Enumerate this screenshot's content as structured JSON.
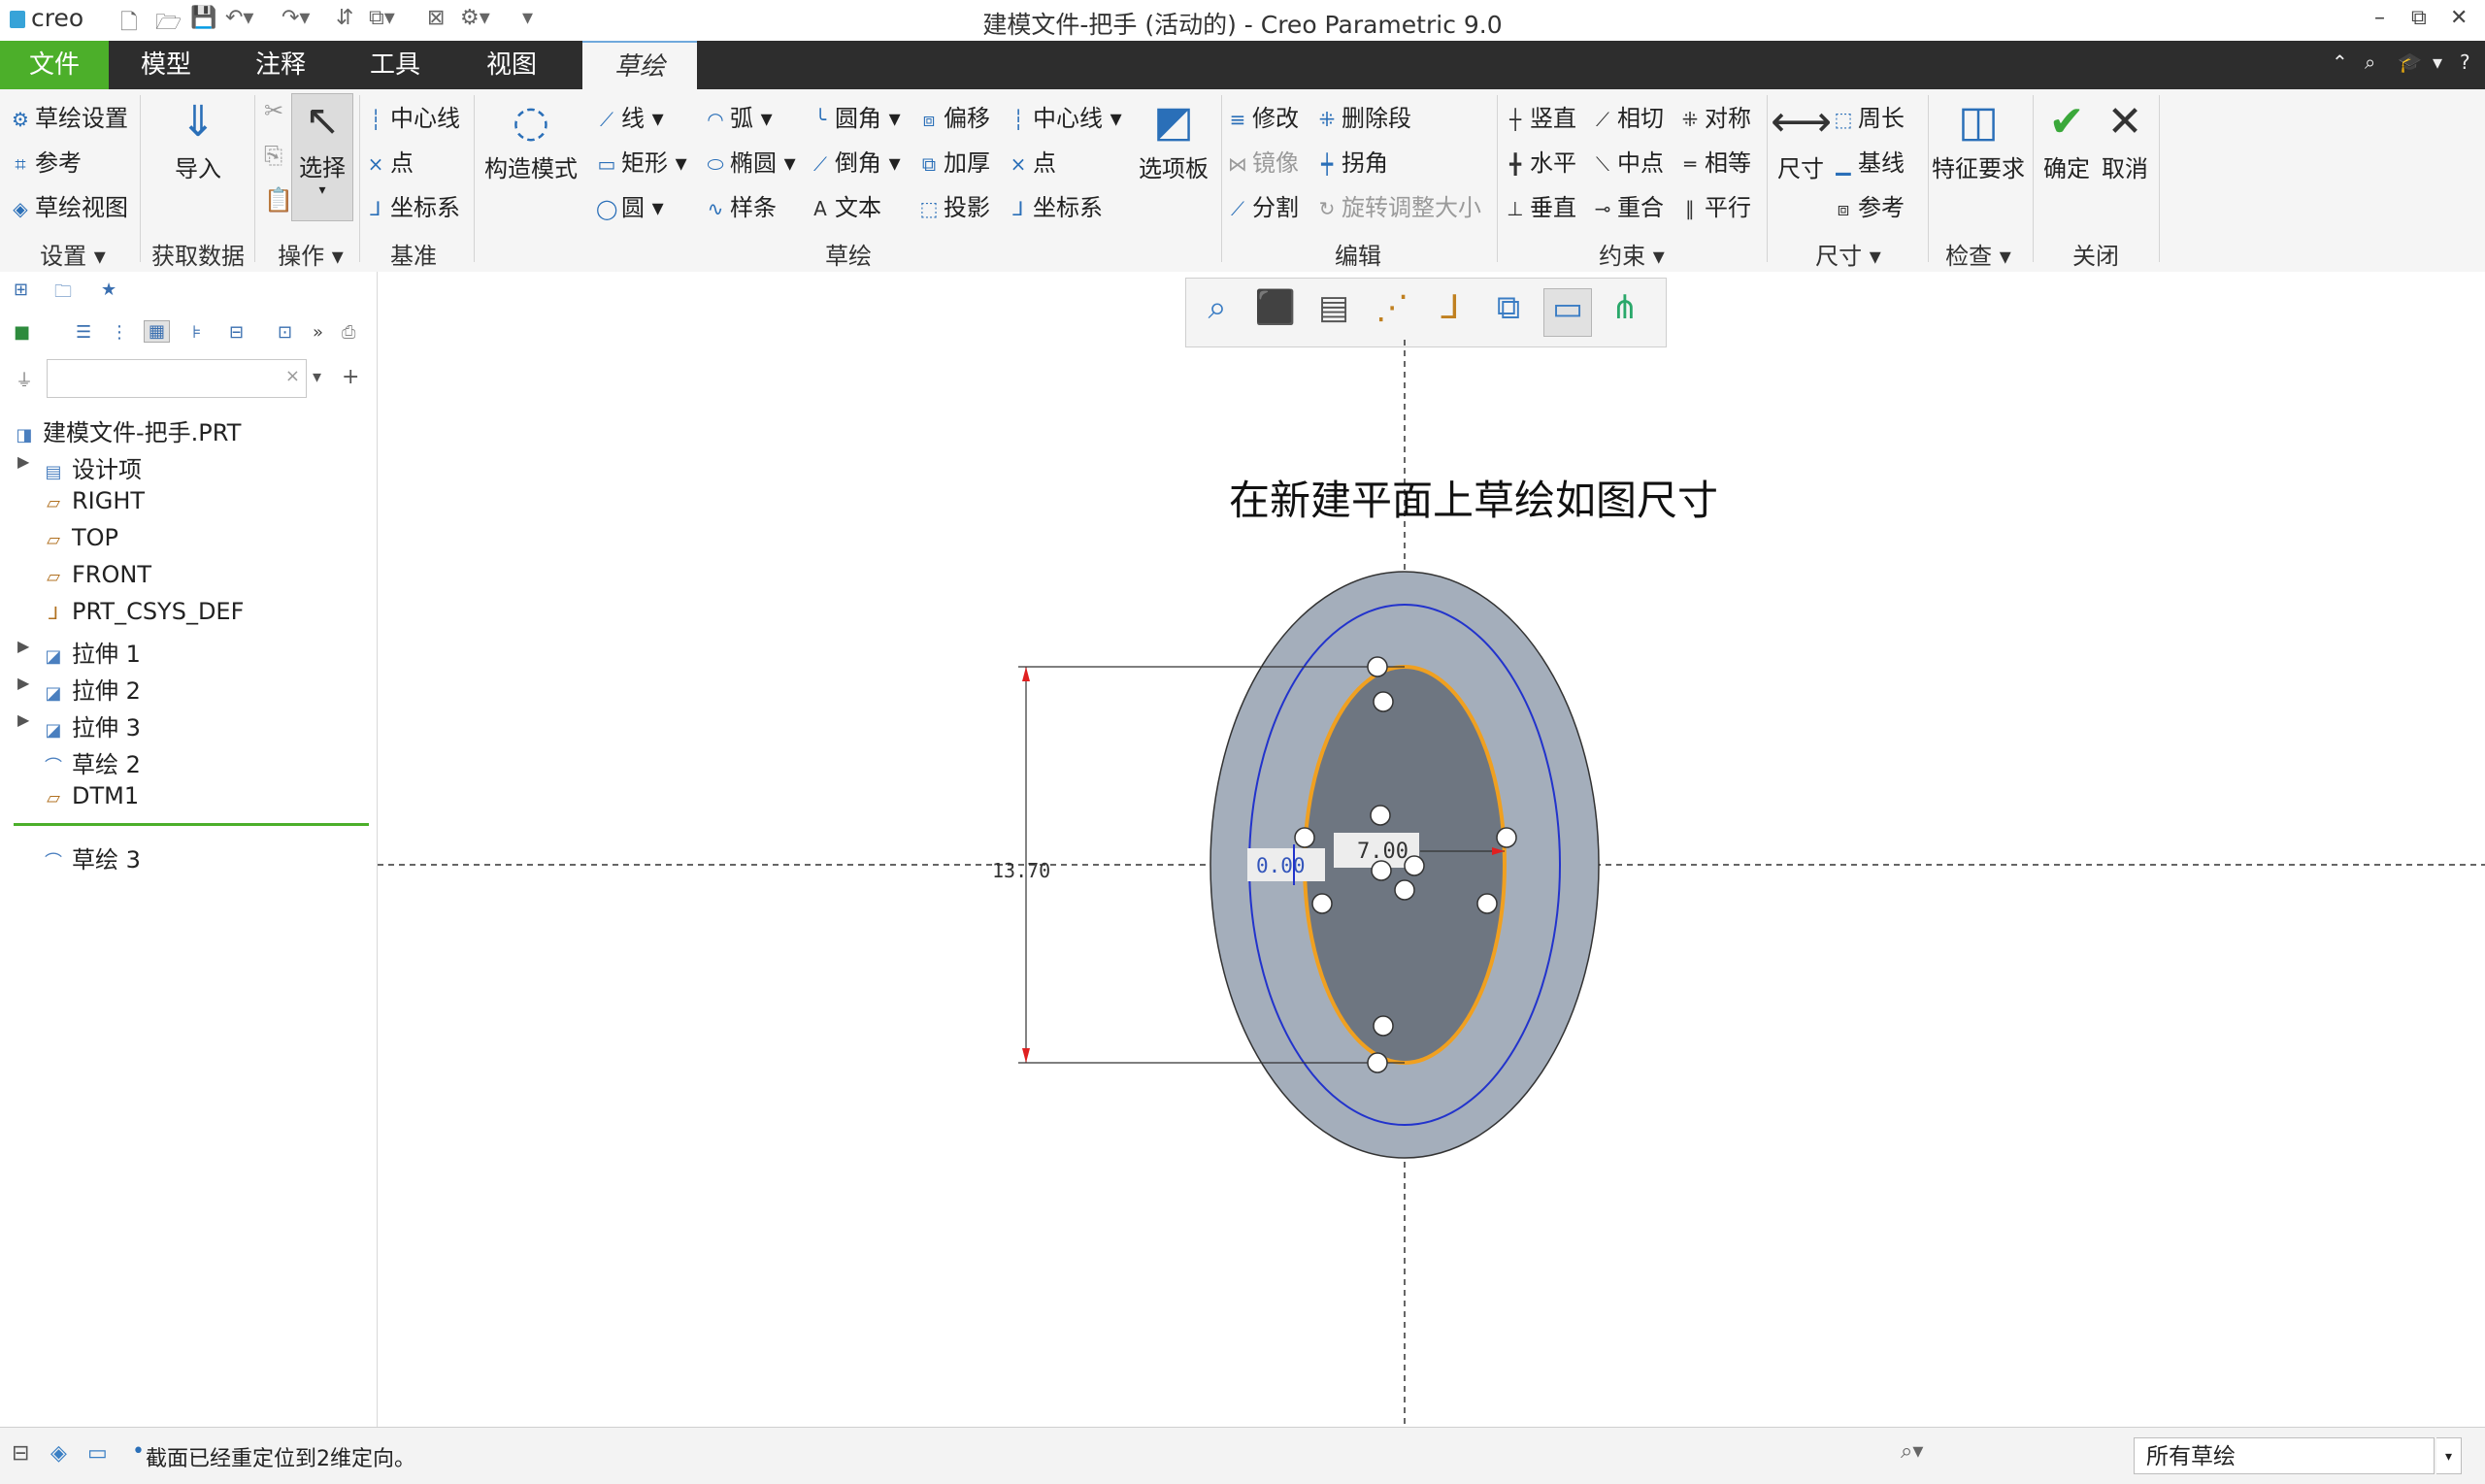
{
  "app": {
    "logo_text": "creo",
    "title": "建模文件-把手 (活动的) - Creo Parametric 9.0"
  },
  "tabs": [
    "文件",
    "模型",
    "注释",
    "工具",
    "视图",
    "草绘"
  ],
  "ribbon": {
    "setup": {
      "items": [
        "草绘设置",
        "参考",
        "草绘视图"
      ],
      "group_label": "设置"
    },
    "get_data": {
      "import_label": "导入",
      "group_label": "获取数据"
    },
    "operations": {
      "select_label": "选择",
      "group_label": "操作"
    },
    "datum": {
      "items": [
        "中心线",
        "点",
        "坐标系"
      ],
      "group_label": "基准"
    },
    "sketch": {
      "construction_mode": "构造模式",
      "col1": [
        "线",
        "矩形",
        "圆"
      ],
      "col2": [
        "弧",
        "椭圆",
        "样条"
      ],
      "col3": [
        "圆角",
        "倒角",
        "文本"
      ],
      "col4": [
        "偏移",
        "加厚",
        "投影"
      ],
      "col5": [
        "中心线",
        "点",
        "坐标系"
      ],
      "palette": "选项板",
      "group_label": "草绘"
    },
    "edit": {
      "items": [
        "修改",
        "删除段",
        "镜像",
        "拐角",
        "分割",
        "旋转调整大小"
      ],
      "group_label": "编辑"
    },
    "constrain": {
      "items": [
        "竖直",
        "相切",
        "对称",
        "水平",
        "中点",
        "相等",
        "垂直",
        "重合",
        "平行"
      ],
      "group_label": "约束"
    },
    "dimension": {
      "dim_label": "尺寸",
      "items": [
        "周长",
        "基线",
        "参考"
      ],
      "group_label": "尺寸"
    },
    "inspect": {
      "feature_req": "特征要求",
      "group_label": "检查"
    },
    "close": {
      "ok": "确定",
      "cancel": "取消",
      "group_label": "关闭"
    }
  },
  "model_tree": {
    "root": "建模文件-把手.PRT",
    "items": [
      "设计项",
      "RIGHT",
      "TOP",
      "FRONT",
      "PRT_CSYS_DEF",
      "拉伸 1",
      "拉伸 2",
      "拉伸 3",
      "草绘 2",
      "DTM1"
    ],
    "active_item": "草绘 3"
  },
  "canvas": {
    "annotation": "在新建平面上草绘如图尺寸",
    "dim_height": "13.70",
    "dim_width": "7.00",
    "dim_offset": "0.00"
  },
  "status": {
    "message": "截面已经重定位到2维定向。",
    "filter_value": "所有草绘"
  },
  "colors": {
    "tab_file": "#4caf2a",
    "tab_bar": "#2d2d2d",
    "outer_face": "#a4aebb",
    "inner_face": "#6e7681",
    "sketch_ellipse": "#f0a020",
    "reference_ellipse": "#2233cc"
  }
}
